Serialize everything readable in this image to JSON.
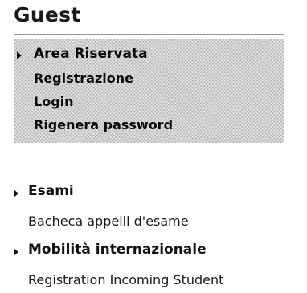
{
  "sidebar": {
    "title": "Guest",
    "reserved_area": {
      "label": "Area Riservata",
      "items": [
        {
          "label": "Registrazione"
        },
        {
          "label": "Login"
        },
        {
          "label": "Rigenera password"
        }
      ]
    },
    "sections": [
      {
        "label": "Esami",
        "items": [
          {
            "label": "Bacheca appelli d'esame"
          }
        ]
      },
      {
        "label": "Mobilità internazionale",
        "items": [
          {
            "label": "Registration Incoming Student"
          }
        ]
      }
    ]
  },
  "icons": {
    "section_marker": "triangle-right-icon"
  },
  "colors": {
    "text": "#111111",
    "panel_background": "#cfcfcf"
  }
}
